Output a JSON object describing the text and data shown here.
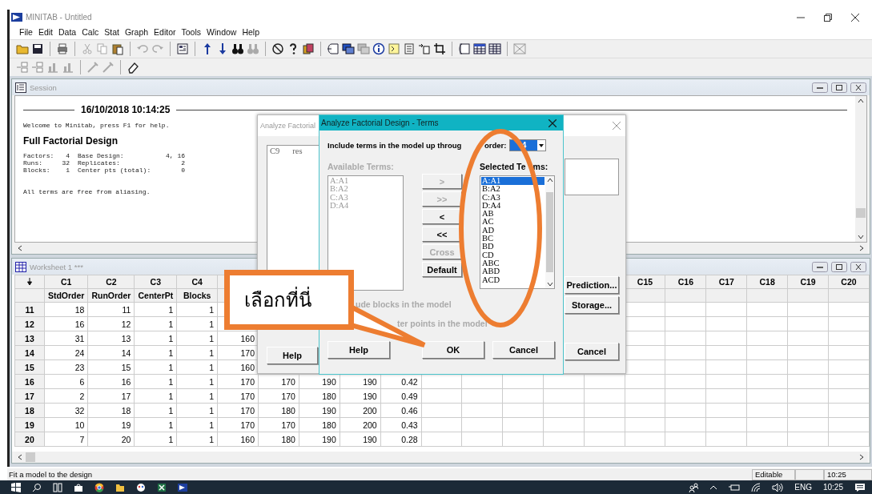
{
  "window": {
    "title": "MINITAB - Untitled"
  },
  "menu": [
    "File",
    "Edit",
    "Data",
    "Calc",
    "Stat",
    "Graph",
    "Editor",
    "Tools",
    "Window",
    "Help"
  ],
  "session": {
    "title": "Session",
    "timestamp": "16/10/2018 10:14:25",
    "welcome": "Welcome to Minitab, press F1 for help.",
    "heading": "Full Factorial Design",
    "summary": [
      [
        "Factors:",
        "4",
        "Base Design:",
        "4, 16"
      ],
      [
        "Runs:",
        "32",
        "Replicates:",
        "2"
      ],
      [
        "Blocks:",
        "1",
        "Center pts (total):",
        "0"
      ]
    ],
    "note": "All terms are free from aliasing."
  },
  "worksheet": {
    "title": "Worksheet 1 ***",
    "columns": [
      {
        "label": "C1",
        "name": "StdOrder"
      },
      {
        "label": "C2",
        "name": "RunOrder"
      },
      {
        "label": "C3",
        "name": "CenterPt"
      },
      {
        "label": "C4",
        "name": "Blocks"
      },
      null,
      null,
      null,
      null,
      null,
      null,
      null,
      null,
      null,
      null,
      {
        "label": "C15"
      },
      {
        "label": "C16"
      },
      {
        "label": "C17"
      },
      {
        "label": "C18"
      },
      {
        "label": "C19"
      },
      {
        "label": "C20"
      }
    ],
    "rows": [
      {
        "row": "11",
        "cells": [
          "18",
          "11",
          "1",
          "1"
        ]
      },
      {
        "row": "12",
        "cells": [
          "16",
          "12",
          "1",
          "1"
        ]
      },
      {
        "row": "13",
        "cells": [
          "31",
          "13",
          "1",
          "1",
          "160"
        ]
      },
      {
        "row": "14",
        "cells": [
          "24",
          "14",
          "1",
          "1",
          "170"
        ]
      },
      {
        "row": "15",
        "cells": [
          "23",
          "15",
          "1",
          "1",
          "160"
        ]
      },
      {
        "row": "16",
        "cells": [
          "6",
          "16",
          "1",
          "1",
          "170",
          "170",
          "190",
          "190",
          "0.42"
        ]
      },
      {
        "row": "17",
        "cells": [
          "2",
          "17",
          "1",
          "1",
          "170",
          "170",
          "180",
          "190",
          "0.49"
        ]
      },
      {
        "row": "18",
        "cells": [
          "32",
          "18",
          "1",
          "1",
          "170",
          "180",
          "190",
          "200",
          "0.46"
        ]
      },
      {
        "row": "19",
        "cells": [
          "10",
          "19",
          "1",
          "1",
          "170",
          "170",
          "180",
          "200",
          "0.43"
        ]
      },
      {
        "row": "20",
        "cells": [
          "7",
          "20",
          "1",
          "1",
          "160",
          "180",
          "190",
          "190",
          "0.28"
        ]
      }
    ]
  },
  "analyze_dialog": {
    "title": "Analyze Factorial",
    "list_items": [
      {
        "column": "C9",
        "name": "res"
      }
    ],
    "help_button": "Help",
    "side_buttons": [
      "Prediction...",
      "Storage..."
    ],
    "cancel_button": "Cancel"
  },
  "terms_dialog": {
    "title": "Analyze Factorial Design - Terms",
    "order_label": "Include terms in the model up throug",
    "order_label_end": "order:",
    "order_value": "4",
    "available_label": "Available Terms:",
    "available_disabled": true,
    "available_terms": [
      "A:A1",
      "B:A2",
      "C:A3",
      "D:A4"
    ],
    "move_buttons": [
      {
        "label": ">",
        "disabled": true
      },
      {
        "label": ">>",
        "disabled": true
      },
      {
        "label": "<",
        "disabled": false
      },
      {
        "label": "<<",
        "disabled": false
      },
      {
        "label": "Cross",
        "disabled": true
      },
      {
        "label": "Default",
        "disabled": false
      }
    ],
    "selected_label": "Selected Te",
    "selected_label_end": "ms:",
    "selected_terms": [
      {
        "label": "A:A1",
        "selected": true
      },
      {
        "label": "B:A2",
        "selected": false
      },
      {
        "label": "C:A3",
        "selected": false
      },
      {
        "label": "D:A4",
        "selected": false
      },
      {
        "label": "AB",
        "selected": false
      },
      {
        "label": "AC",
        "selected": false
      },
      {
        "label": "AD",
        "selected": false
      },
      {
        "label": "BC",
        "selected": false
      },
      {
        "label": "BD",
        "selected": false
      },
      {
        "label": "CD",
        "selected": false
      },
      {
        "label": "ABC",
        "selected": false
      },
      {
        "label": "ABD",
        "selected": false
      },
      {
        "label": "ACD",
        "selected": false
      }
    ],
    "options": [
      {
        "label": "ude blocks in the model",
        "disabled": true
      },
      {
        "label": "ter points in the model",
        "disabled": true
      }
    ],
    "buttons": [
      "Help",
      "OK",
      "Cancel"
    ]
  },
  "annotation": {
    "callout_text": "เลือกที่นี่"
  },
  "status_bar": {
    "message": "Fit a model to the design",
    "mode": "Editable",
    "time": "10:25"
  },
  "taskbar": {
    "language": "ENG",
    "time": "10:25"
  }
}
